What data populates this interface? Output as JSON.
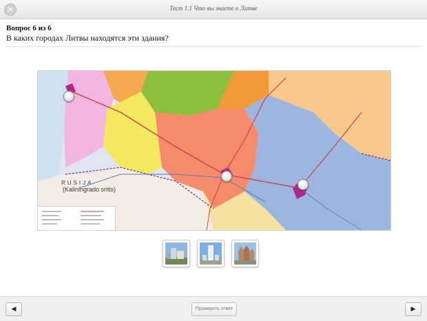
{
  "window": {
    "title": "Тест 1.1 Что вы знаете о Литве"
  },
  "question": {
    "counter": "Вопрос 6 из 6",
    "text": "В каких городах Литвы находятся эти здания?"
  },
  "map": {
    "labels": {
      "country": "RUSIJA",
      "region": "(Kaliningrado sritis)"
    },
    "pins": [
      "pin-klaipeda",
      "pin-kaunas",
      "pin-vilnius"
    ]
  },
  "thumbnails": [
    "building-photo-1",
    "building-photo-2",
    "building-photo-3"
  ],
  "footer": {
    "prev_icon": "◀",
    "check_label": "Проверить ответ",
    "next_icon": "▶"
  },
  "icons": {
    "close": "✕"
  }
}
